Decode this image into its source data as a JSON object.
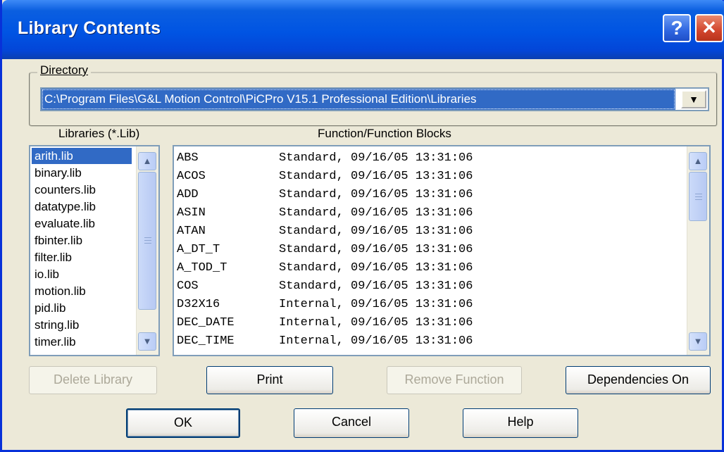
{
  "window": {
    "title": "Library Contents"
  },
  "directory": {
    "label": "Directory",
    "value": "C:\\Program Files\\G&L Motion Control\\PiCPro V15.1 Professional Edition\\Libraries"
  },
  "libraries": {
    "header": "Libraries (*.Lib)",
    "items": [
      "arith.lib",
      "binary.lib",
      "counters.lib",
      "datatype.lib",
      "evaluate.lib",
      "fbinter.lib",
      "filter.lib",
      "io.lib",
      "motion.lib",
      "pid.lib",
      "string.lib",
      "timer.lib"
    ],
    "selected": "arith.lib"
  },
  "functions": {
    "header": "Function/Function Blocks",
    "rows": [
      {
        "name": "ABS",
        "info": "Standard, 09/16/05 13:31:06"
      },
      {
        "name": "ACOS",
        "info": "Standard, 09/16/05 13:31:06"
      },
      {
        "name": "ADD",
        "info": "Standard, 09/16/05 13:31:06"
      },
      {
        "name": "ASIN",
        "info": "Standard, 09/16/05 13:31:06"
      },
      {
        "name": "ATAN",
        "info": "Standard, 09/16/05 13:31:06"
      },
      {
        "name": "A_DT_T",
        "info": "Standard, 09/16/05 13:31:06"
      },
      {
        "name": "A_TOD_T",
        "info": "Standard, 09/16/05 13:31:06"
      },
      {
        "name": "COS",
        "info": "Standard, 09/16/05 13:31:06"
      },
      {
        "name": "D32X16",
        "info": "Internal, 09/16/05 13:31:06"
      },
      {
        "name": "DEC_DATE",
        "info": "Internal, 09/16/05 13:31:06"
      },
      {
        "name": "DEC_TIME",
        "info": "Internal, 09/16/05 13:31:06"
      }
    ]
  },
  "buttons": {
    "delete_library": "Delete Library",
    "print": "Print",
    "remove_function": "Remove Function",
    "dependencies_on": "Dependencies On",
    "ok": "OK",
    "cancel": "Cancel",
    "help": "Help"
  },
  "icons": {
    "help": "?",
    "close": "✕",
    "dropdown": "▼",
    "scroll_up": "▲",
    "scroll_down": "▼"
  },
  "colors": {
    "title_bar": "#0054e3",
    "selection": "#316ac5",
    "dialog_bg": "#ece9d8"
  }
}
